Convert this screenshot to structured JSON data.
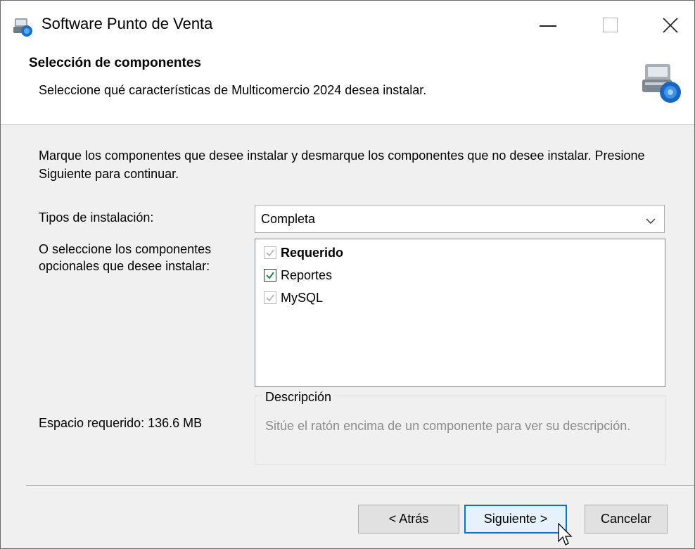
{
  "window": {
    "title": "Software Punto de Venta",
    "controls": {
      "minimize": "minimize",
      "maximize": "maximize",
      "close": "close"
    }
  },
  "header": {
    "title": "Selección de componentes",
    "subtitle": "Seleccione qué características de Multicomercio 2024 desea instalar.",
    "icon": "installer-icon"
  },
  "body": {
    "intro": "Marque los componentes que desee instalar y desmarque los componentes que no desee instalar. Presione Siguiente para continuar.",
    "install_types_label": "Tipos de instalación:",
    "install_type_selected": "Completa",
    "components_label": "O seleccione los componentes opcionales que desee instalar:",
    "components": [
      {
        "label": "Requerido",
        "checked": true,
        "enabled": false,
        "bold": true
      },
      {
        "label": "Reportes",
        "checked": true,
        "enabled": true,
        "bold": false
      },
      {
        "label": "MySQL",
        "checked": true,
        "enabled": false,
        "bold": false
      }
    ],
    "space_required": "Espacio requerido: 136.6 MB",
    "description_legend": "Descripción",
    "description_text": "Sitúe el ratón encima de un componente para ver su descripción."
  },
  "buttons": {
    "back": "< Atrás",
    "next": "Siguiente >",
    "cancel": "Cancelar"
  },
  "colors": {
    "accent": "#0078d7",
    "checkmark_active": "#1a8a3a",
    "checkmark_disabled": "#b4b4b4",
    "disabled_text": "#8c8c8c"
  }
}
